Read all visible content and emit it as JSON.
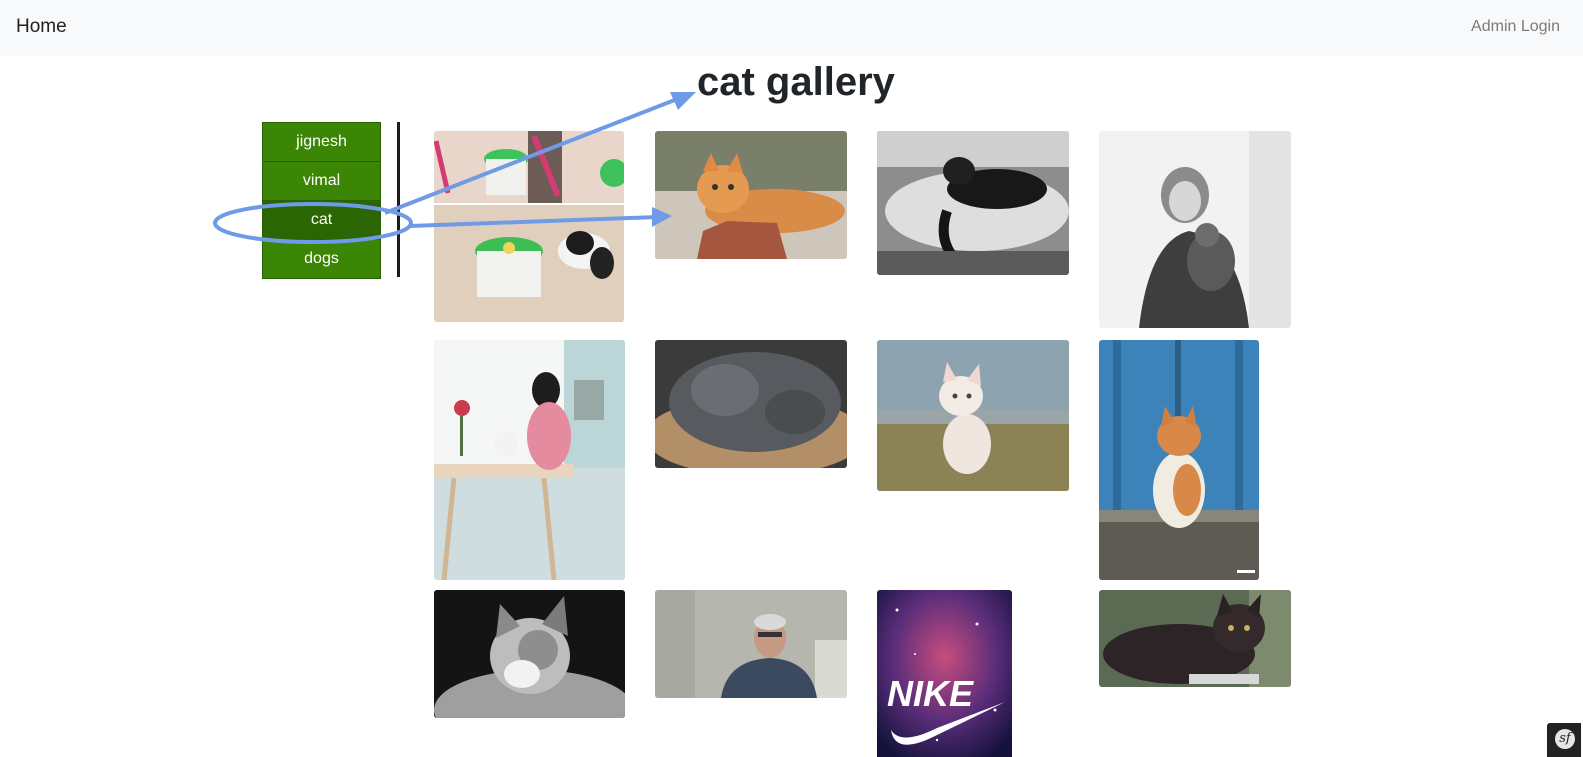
{
  "navbar": {
    "home_label": "Home",
    "admin_label": "Admin Login"
  },
  "page": {
    "title": "cat gallery"
  },
  "sidebar": {
    "items": [
      {
        "label": "jignesh",
        "active": false
      },
      {
        "label": "vimal",
        "active": false
      },
      {
        "label": "cat",
        "active": true
      },
      {
        "label": "dogs",
        "active": false
      }
    ]
  },
  "gallery": {
    "images": [
      {
        "subject": "cat-water-fountain-photo"
      },
      {
        "subject": "orange-kitten-photo"
      },
      {
        "subject": "black-cat-sleeping-photo"
      },
      {
        "subject": "woman-holding-cat-photo"
      },
      {
        "subject": "woman-with-cat-at-table-photo"
      },
      {
        "subject": "grey-cat-in-basket-photo"
      },
      {
        "subject": "white-kitten-on-hay-photo"
      },
      {
        "subject": "orange-cat-blue-door-photo"
      },
      {
        "subject": "bw-cat-portrait-photo"
      },
      {
        "subject": "man-webcam-photo"
      },
      {
        "subject": "nike-galaxy-poster",
        "caption": "NIKE"
      },
      {
        "subject": "burmese-cat-photo"
      }
    ]
  },
  "annotations": {
    "color": "#6f9be6",
    "description": "hand-drawn circle around cat menu item with arrows to title and first photo"
  },
  "toolbar": {
    "icon": "symfony-debug-icon",
    "glyph": "sf"
  },
  "colors": {
    "menu_bg": "#3b8605",
    "menu_active": "#2c6503",
    "navbar_bg": "#f8f9fa"
  }
}
